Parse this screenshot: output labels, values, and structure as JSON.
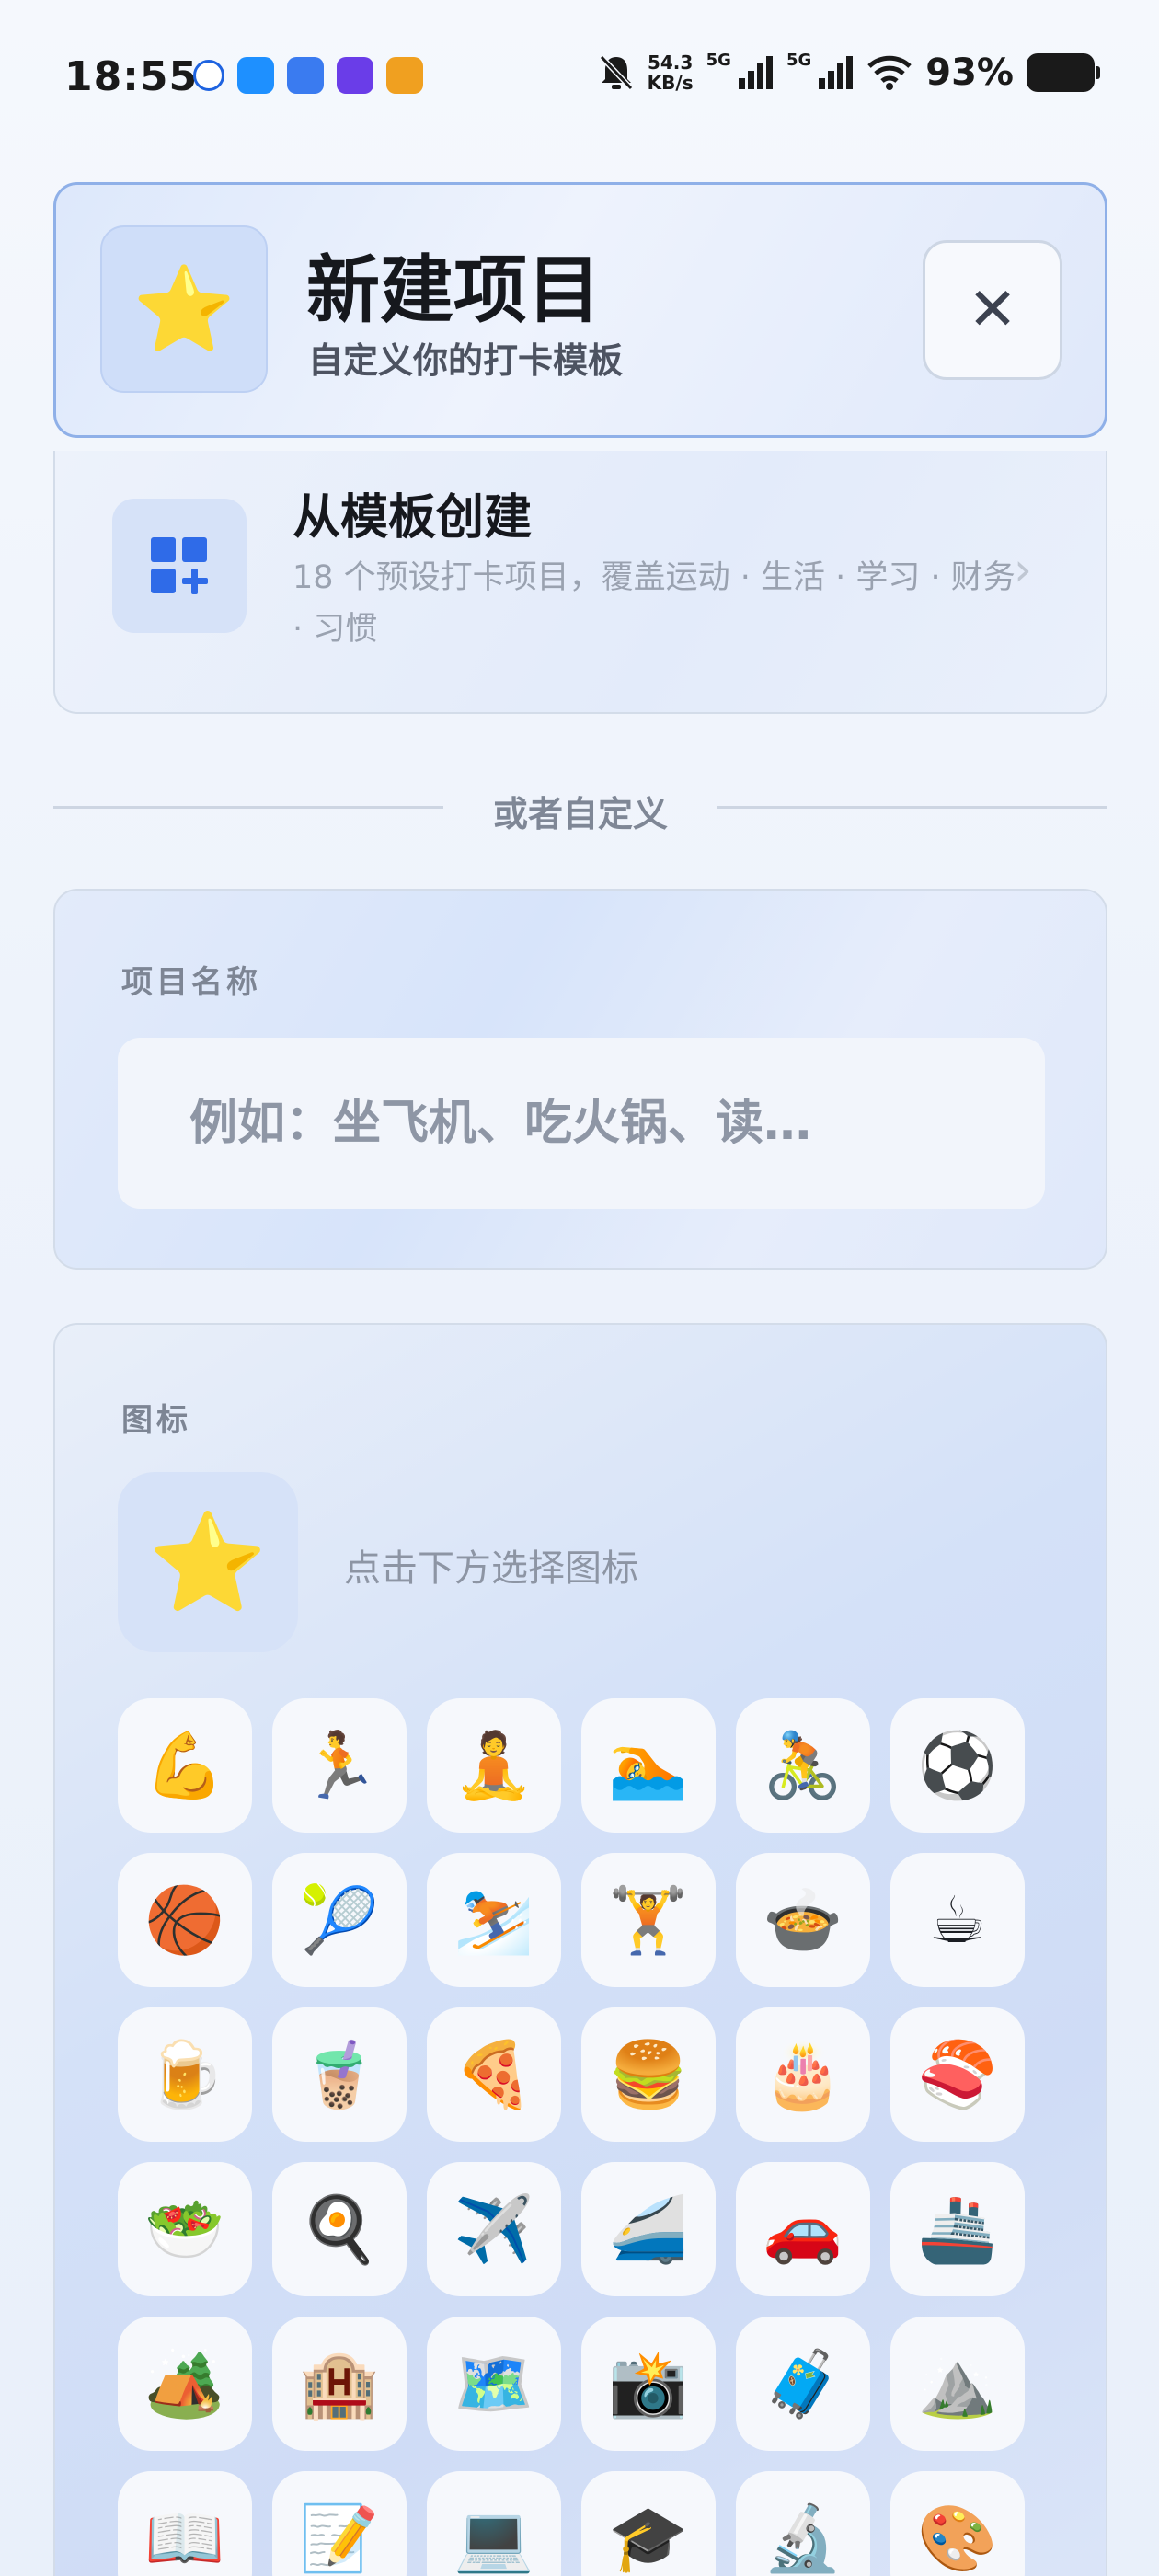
{
  "status_bar": {
    "time": "18:55",
    "net_speed_value": "54.3",
    "net_speed_unit": "KB/s",
    "sim1_label": "5G",
    "sim2_label": "5G",
    "battery": "93%"
  },
  "header": {
    "icon": "⭐",
    "title": "新建项目",
    "subtitle": "自定义你的打卡模板",
    "close_symbol": "✕"
  },
  "template": {
    "title": "从模板创建",
    "description": "18 个预设打卡项目，覆盖运动 · 生活 · 学习 · 财务 · 习惯",
    "chevron": "›"
  },
  "divider": {
    "text": "或者自定义"
  },
  "name_section": {
    "label": "项目名称",
    "placeholder": "例如：坐飞机、吃火锅、读…"
  },
  "icon_section": {
    "label": "图标",
    "selected_icon": "⭐",
    "hint": "点击下方选择图标",
    "emojis": [
      "💪",
      "🏃",
      "🧘",
      "🏊",
      "🚴",
      "⚽",
      "🏀",
      "🎾",
      "⛷️",
      "🏋️",
      "🍲",
      "☕",
      "🍺",
      "🧋",
      "🍕",
      "🍔",
      "🎂",
      "🍣",
      "🥗",
      "🍳",
      "✈️",
      "🚄",
      "🚗",
      "🚢",
      "🏕️",
      "🏨",
      "🗺️",
      "📸",
      "🧳",
      "⛰️",
      "📖",
      "📝",
      "💻",
      "🎓",
      "🔬",
      "🎨"
    ]
  },
  "colors": {
    "accent": "#2f6be8",
    "header_border": "#8fb0e8"
  }
}
